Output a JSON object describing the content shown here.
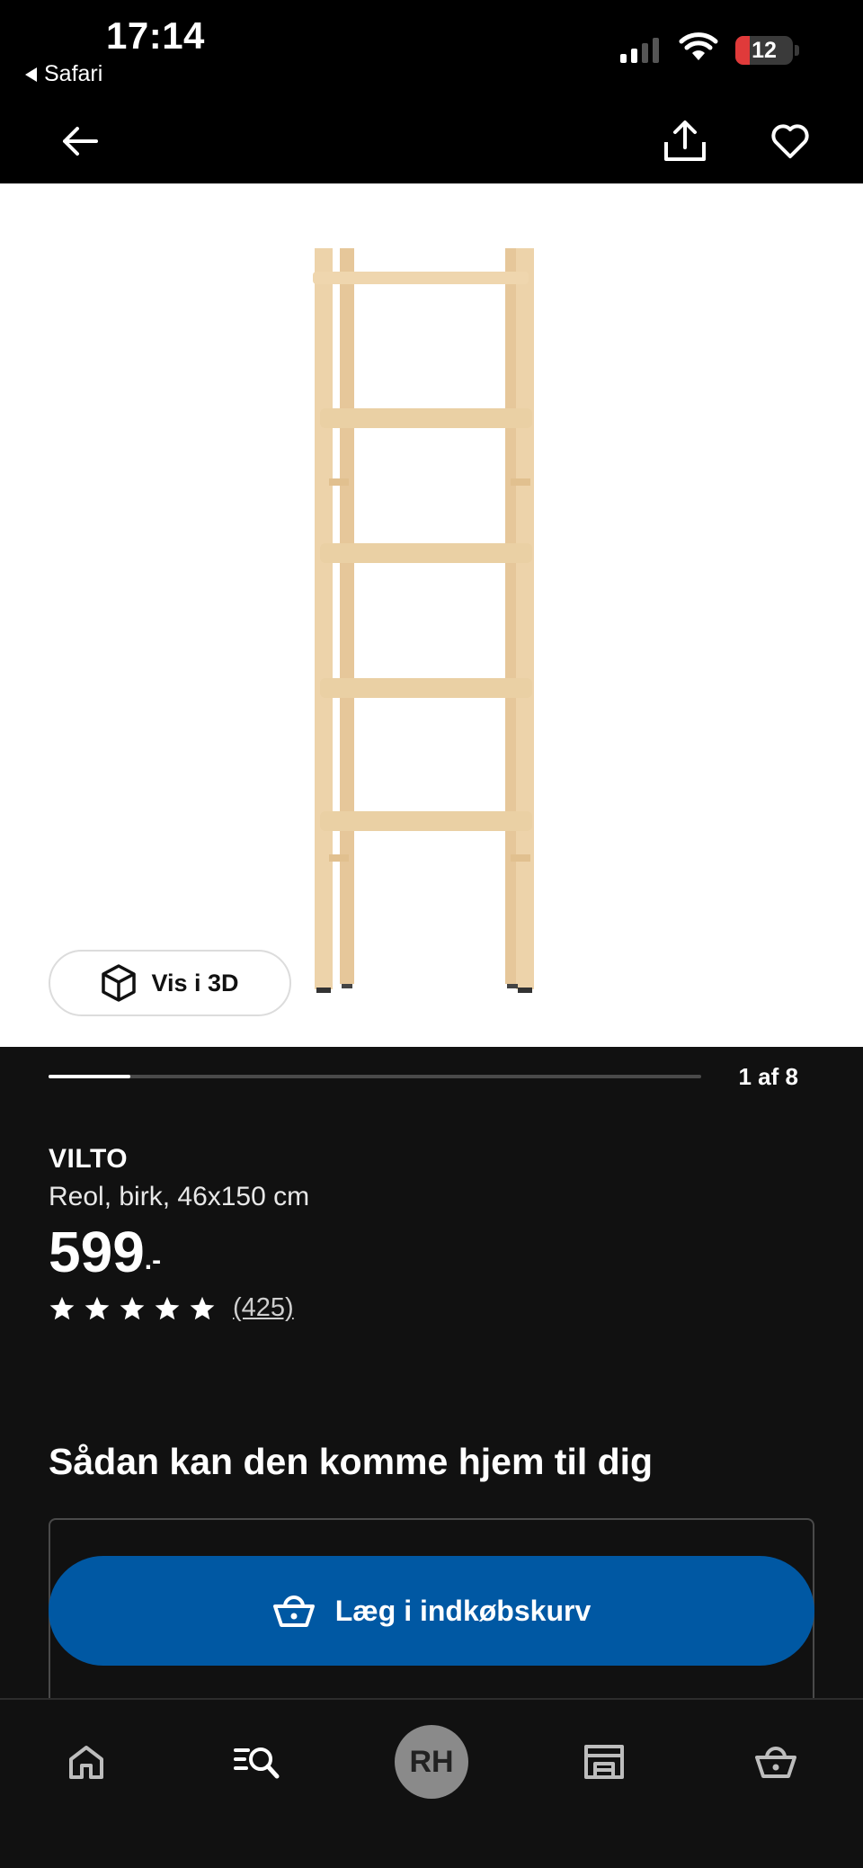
{
  "status_bar": {
    "time": "17:14",
    "back_app": "Safari",
    "battery": "12"
  },
  "nav": {
    "back_icon": "arrow-left-icon",
    "share_icon": "share-icon",
    "favorite_icon": "heart-icon"
  },
  "gallery": {
    "view_3d_label": "Vis i 3D",
    "counter": "1 af 8",
    "progress_fraction": 0.125
  },
  "product": {
    "brand": "VILTO",
    "description": "Reol, birk, 46x150 cm",
    "price": "599",
    "price_suffix": ".-",
    "rating_stars": 5,
    "review_count": "(425)"
  },
  "delivery": {
    "heading": "Sådan kan den komme hjem til dig"
  },
  "cart": {
    "label": "Læg i indkøbskurv"
  },
  "tab_bar": {
    "avatar_initials": "RH",
    "items": [
      "home-icon",
      "search-icon",
      "profile-avatar",
      "store-icon",
      "basket-icon"
    ]
  },
  "colors": {
    "accent_blue": "#0058a3",
    "background": "#111111",
    "battery_low": "#e03a3a"
  }
}
